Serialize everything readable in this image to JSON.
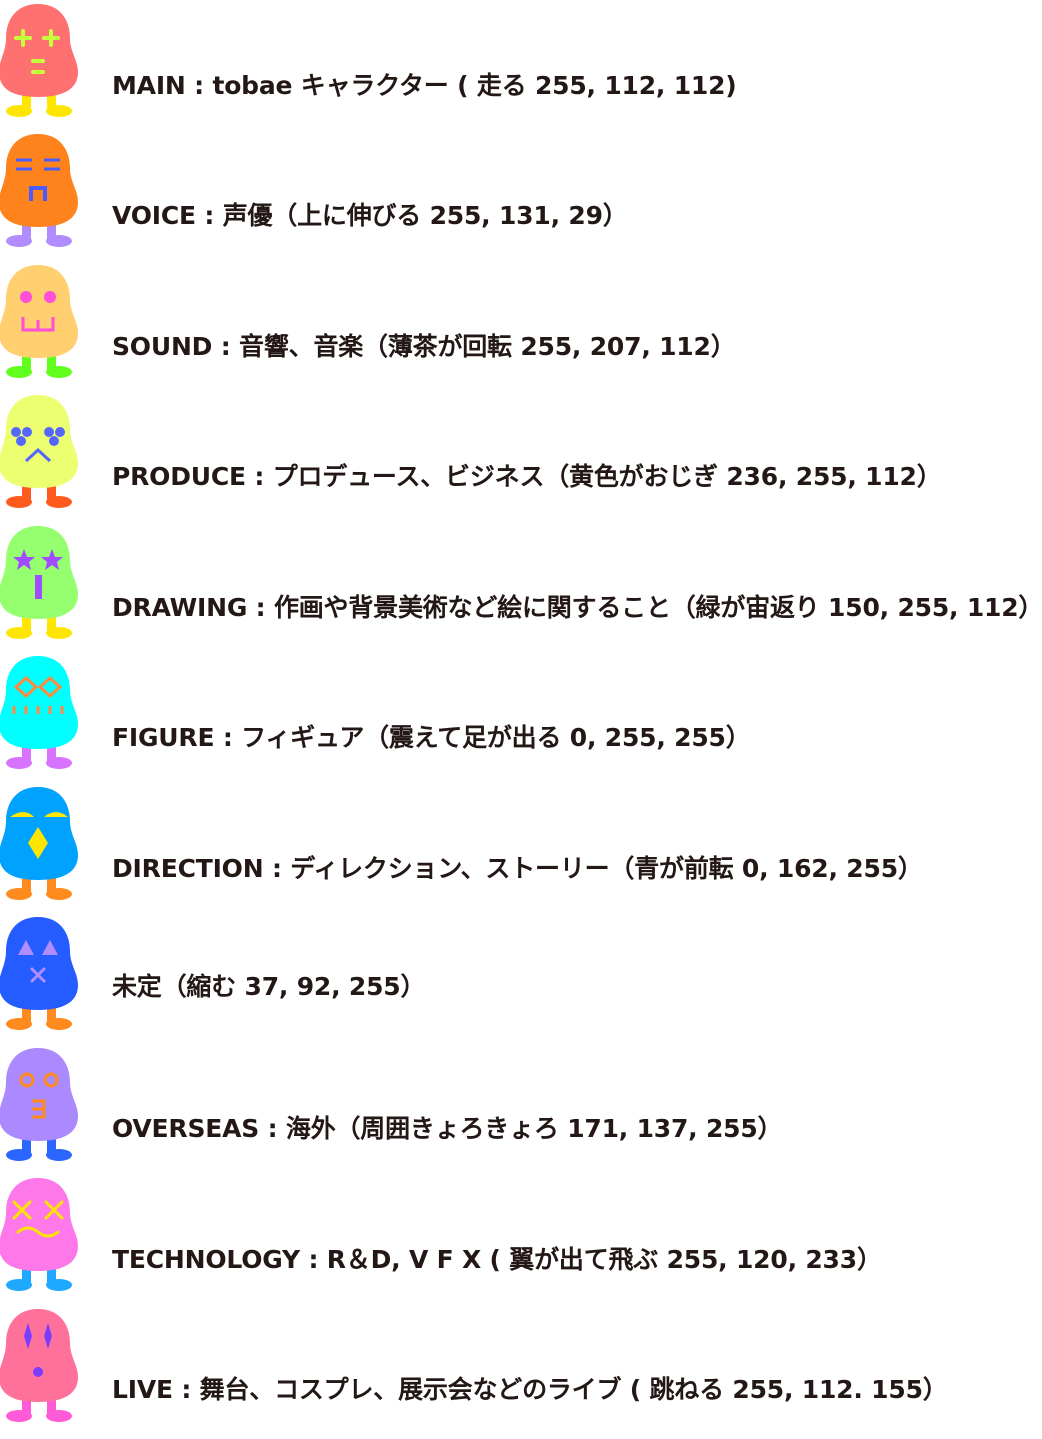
{
  "rows": [
    {
      "text": "MAIN : tobae キャラクター ( 走る 255, 112, 112)",
      "body": "#ff7070",
      "legs": "#ffe600",
      "face": "plus",
      "face_color": "#c6ff3c"
    },
    {
      "text": "VOICE : 声優（上に伸びる 255, 131, 29）",
      "body": "#ff831d",
      "legs": "#b08cff",
      "face": "lines",
      "face_color": "#4a5cff"
    },
    {
      "text": "SOUND : 音響、音楽（薄茶が回転 255, 207, 112）",
      "body": "#ffcf70",
      "legs": "#60ff1e",
      "face": "dots",
      "face_color": "#ff4fd8"
    },
    {
      "text": "PRODUCE : プロデュース、ビジネス（黄色がおじぎ 236, 255, 112）",
      "body": "#ecff70",
      "legs": "#ff5a1e",
      "face": "clover",
      "face_color": "#5566ff"
    },
    {
      "text": "DRAWING : 作画や背景美術など絵に関すること（緑が宙返り 150, 255, 112）",
      "body": "#96ff70",
      "legs": "#ffe600",
      "face": "stars",
      "face_color": "#a24cff"
    },
    {
      "text": "FIGURE : フィギュア（震えて足が出る 0, 255, 255）",
      "body": "#00ffff",
      "legs": "#d773ff",
      "face": "glasses",
      "face_color": "#ff8a3d"
    },
    {
      "text": "DIRECTION : ディレクション、ストーリー（青が前転 0, 162, 255）",
      "body": "#00a2ff",
      "legs": "#ff8a1e",
      "face": "bird",
      "face_color": "#ffe600"
    },
    {
      "text": "未定（縮む 37, 92, 255）",
      "body": "#255cff",
      "legs": "#ff8a1e",
      "face": "triangles",
      "face_color": "#b08cff"
    },
    {
      "text": "OVERSEAS : 海外（周囲きょろきょろ 171, 137, 255）",
      "body": "#ab89ff",
      "legs": "#2a66ff",
      "face": "rings",
      "face_color": "#ff8a1e"
    },
    {
      "text": "TECHNOLOGY : R＆D, V F X ( 翼が出て飛ぶ 255, 120, 233）",
      "body": "#ff78e9",
      "legs": "#1ea8ff",
      "face": "x",
      "face_color": "#ffe600"
    },
    {
      "text": "LIVE : 舞台、コスプレ、展示会などのライブ ( 跳ねる 255, 112. 155）",
      "body": "#ff709b",
      "legs": "#ff5ad8",
      "face": "diamonds",
      "face_color": "#7a3cff"
    }
  ]
}
